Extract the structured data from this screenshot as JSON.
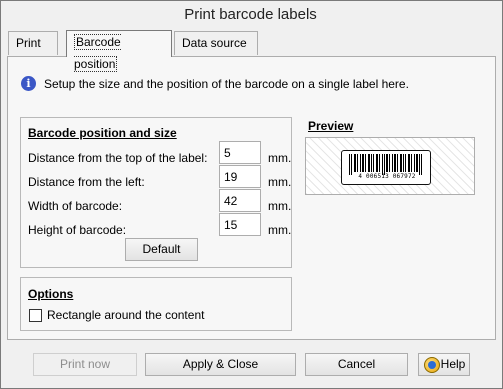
{
  "window": {
    "title": "Print barcode labels"
  },
  "tabs": [
    {
      "label": "Print"
    },
    {
      "label": "Barcode position"
    },
    {
      "label": "Data source"
    }
  ],
  "info": {
    "icon": "info-icon",
    "text": "Setup the size and the position of the barcode on a single label here."
  },
  "position_group": {
    "title": "Barcode position and size",
    "rows": [
      {
        "label": "Distance from the top of the label:",
        "value": "5",
        "unit": "mm."
      },
      {
        "label": "Distance from the left:",
        "value": "19",
        "unit": "mm."
      },
      {
        "label": "Width of barcode:",
        "value": "42",
        "unit": "mm."
      },
      {
        "label": "Height of barcode:",
        "value": "15",
        "unit": "mm."
      }
    ],
    "default_label": "Default"
  },
  "options_group": {
    "title": "Options",
    "checkbox_label": "Rectangle around the content",
    "checked": false
  },
  "preview": {
    "title": "Preview",
    "barcode_digits": "4 006513 067972"
  },
  "buttons": {
    "print_now": "Print now",
    "apply_close": "Apply & Close",
    "cancel": "Cancel",
    "help": "Help"
  },
  "colors": {
    "accent": "#3b57c6"
  }
}
